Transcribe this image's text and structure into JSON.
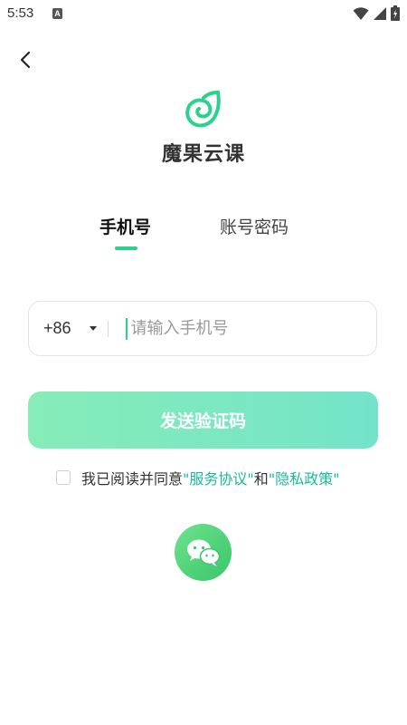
{
  "status_bar": {
    "time": "5:53",
    "notification_icon": "A",
    "icons": [
      "wifi-icon",
      "signal-icon",
      "battery-icon"
    ]
  },
  "header": {
    "back_icon": "chevron-left-icon"
  },
  "brand": {
    "logo_icon": "swirl-logo-icon",
    "app_name": "魔果云课",
    "accent_color": "#2bd18f"
  },
  "tabs": [
    {
      "label": "手机号",
      "active": true
    },
    {
      "label": "账号密码",
      "active": false
    }
  ],
  "phone_form": {
    "country_code": "+86",
    "placeholder": "请输入手机号",
    "value": ""
  },
  "send_button": {
    "label": "发送验证码"
  },
  "agreement": {
    "checked": false,
    "prefix": "我已阅读并同意",
    "service_link": "\"服务协议\"",
    "conjunction": "和",
    "privacy_link": "\"隐私政策\""
  },
  "social_login": {
    "wechat_icon": "wechat-icon"
  }
}
